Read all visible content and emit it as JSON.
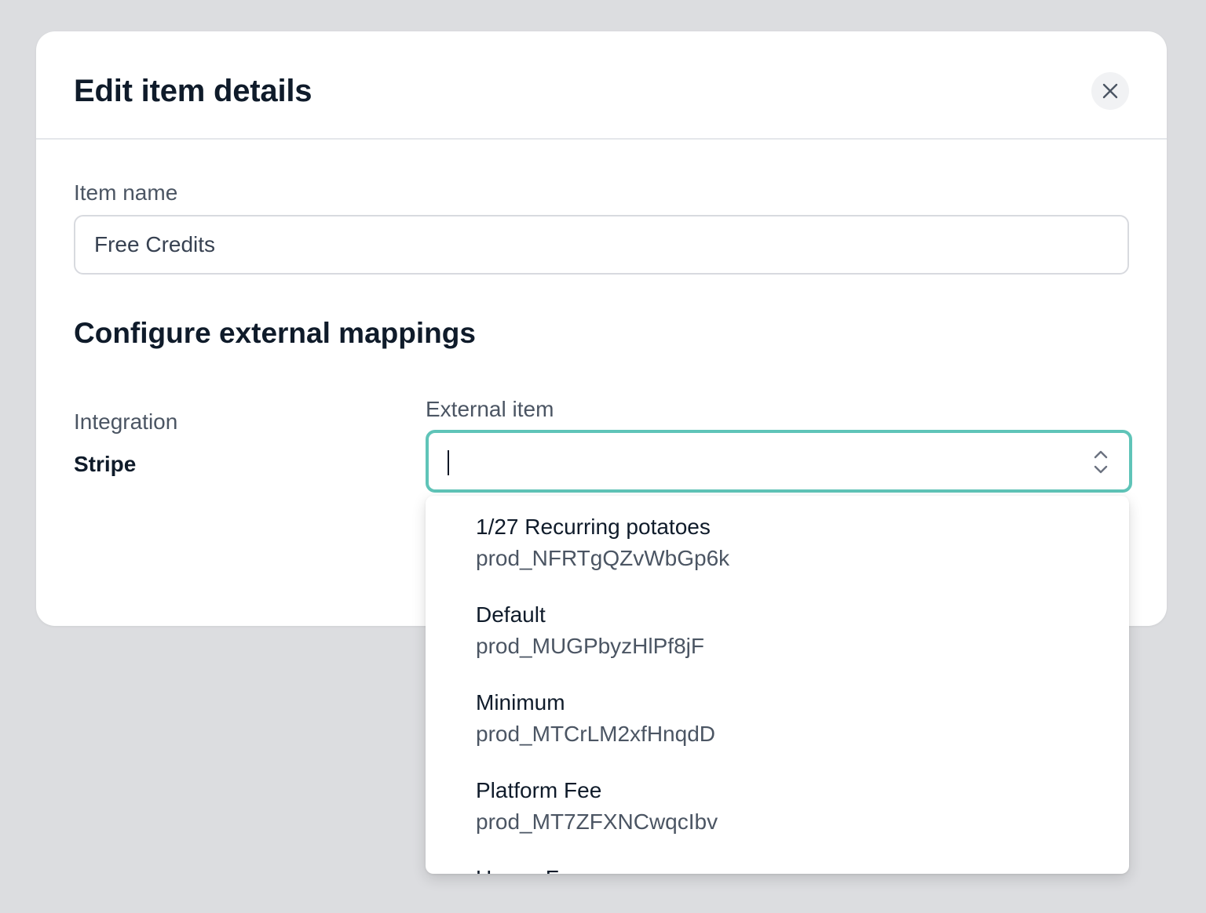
{
  "modal": {
    "title": "Edit item details"
  },
  "item_name": {
    "label": "Item name",
    "value": "Free Credits"
  },
  "mappings": {
    "title": "Configure external mappings",
    "integration_label": "Integration",
    "integration_value": "Stripe",
    "external_item_label": "External item",
    "external_item_value": ""
  },
  "dropdown": {
    "options": [
      {
        "name": "1/27 Recurring potatoes",
        "id": "prod_NFRTgQZvWbGp6k"
      },
      {
        "name": "Default",
        "id": "prod_MUGPbyzHlPf8jF"
      },
      {
        "name": "Minimum",
        "id": "prod_MTCrLM2xfHnqdD"
      },
      {
        "name": "Platform Fee",
        "id": "prod_MT7ZFXNCwqcIbv"
      },
      {
        "name": "Usage Fee",
        "id": ""
      }
    ]
  },
  "colors": {
    "focus_border": "#5fc4b8",
    "backdrop": "#dcdde0"
  },
  "icons": {
    "close": "close-icon",
    "select": "chevron-up-down-icon"
  }
}
